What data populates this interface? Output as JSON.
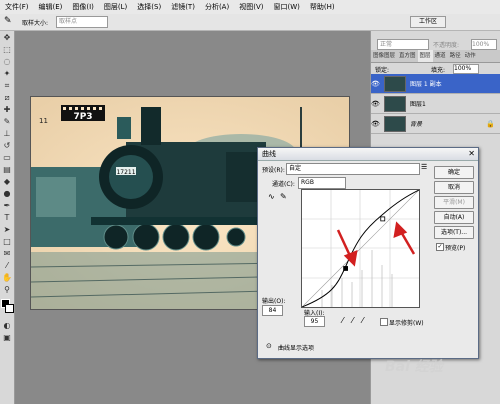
{
  "menu": [
    "文件(F)",
    "编辑(E)",
    "图像(I)",
    "图层(L)",
    "选择(S)",
    "滤镜(T)",
    "分析(A)",
    "视图(V)",
    "窗口(W)",
    "帮助(H)"
  ],
  "options": {
    "feather_label": "取样大小:",
    "feather_value": "取样点",
    "workspace": "工作区"
  },
  "panel": {
    "mode_value": "正常",
    "opacity_label": "不透明度:",
    "opacity_value": "100%",
    "lock_label": "锁定:",
    "fill_label": "填充:",
    "fill_value": "100%",
    "tabs": [
      "图像图层",
      "直方图",
      "图层",
      "通道",
      "路径",
      "动作"
    ],
    "layers": [
      {
        "name": "图层 1 副本"
      },
      {
        "name": "图层1"
      },
      {
        "name": "背景"
      }
    ]
  },
  "photo": {
    "sign_text": "7P3",
    "plate_text": "17211",
    "side_text": "11"
  },
  "curves": {
    "title": "曲线",
    "preset_label": "预设(R):",
    "preset_value": "自定",
    "channel_label": "通道(C):",
    "channel_value": "RGB",
    "output_label": "输出(O):",
    "output_value": "84",
    "input_label": "输入(I):",
    "input_value": "95",
    "clipping_label": "显示修剪(W)",
    "options_label": "曲线显示选项",
    "buttons": {
      "ok": "确定",
      "cancel": "取消",
      "smooth": "平滑(M)",
      "auto": "自动(A)",
      "options": "选项(T)...",
      "preview": "预览(P)"
    },
    "control_points": [
      {
        "input": 95,
        "output": 84
      },
      {
        "input": 176,
        "output": 192
      }
    ]
  },
  "watermark": "Bai 经验",
  "colors": {
    "selected_layer": "#3a64c8",
    "arrow": "#d22020",
    "canvas_bg": "#fbe6c5"
  }
}
